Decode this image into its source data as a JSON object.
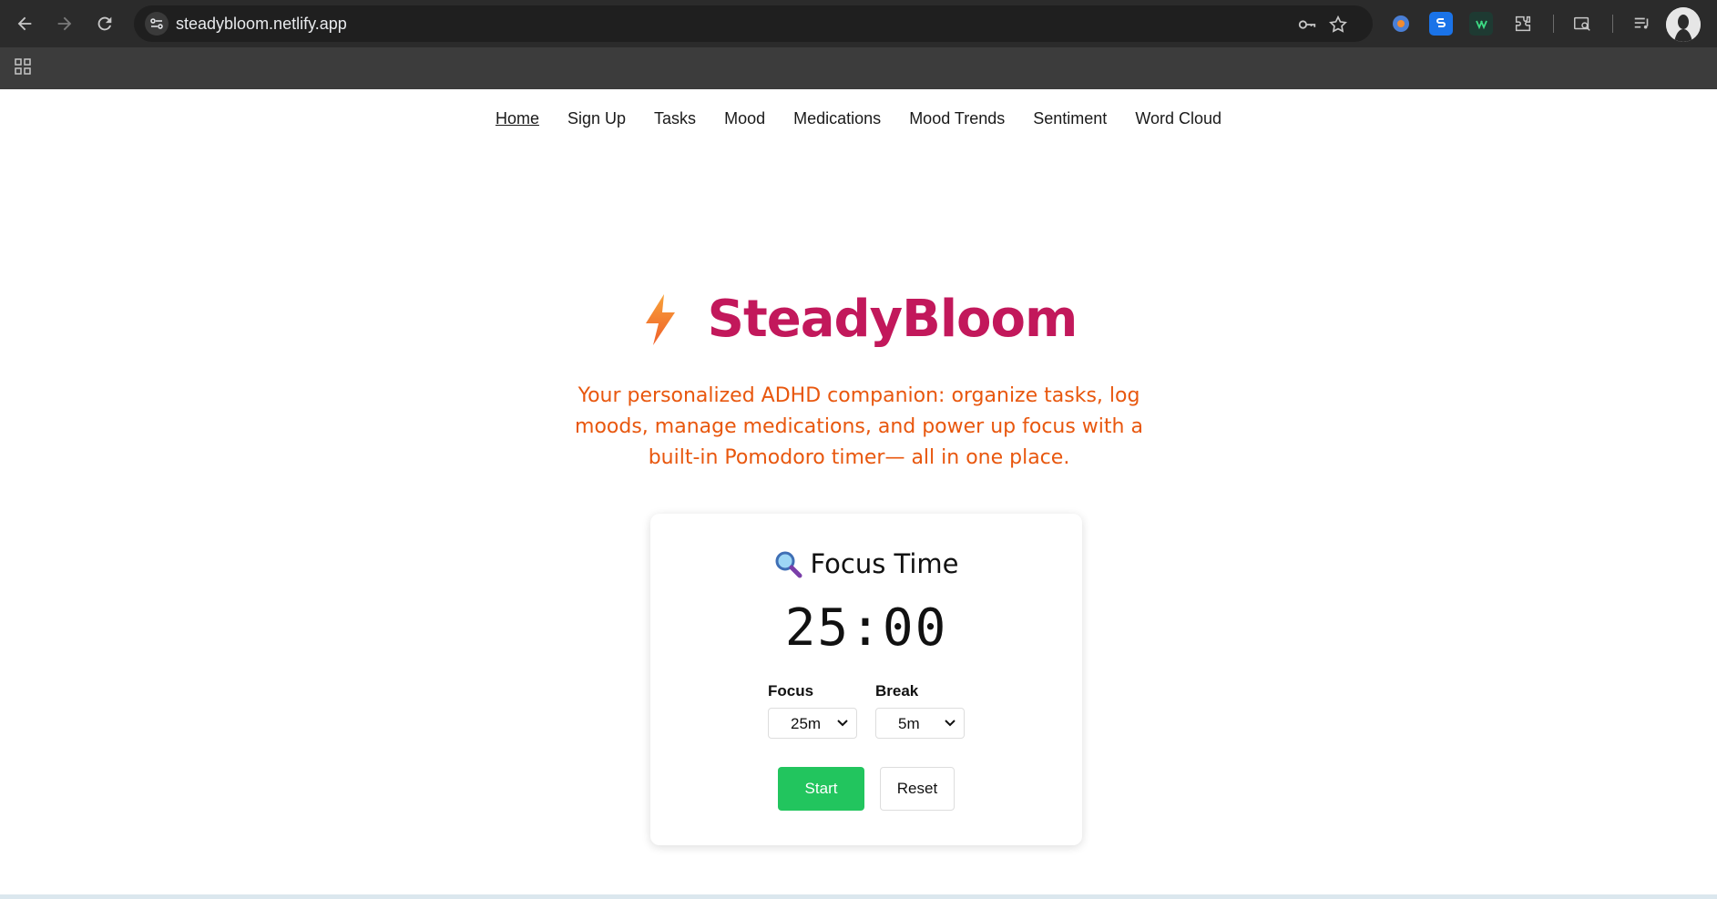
{
  "browser": {
    "url": "steadybloom.netlify.app"
  },
  "nav": {
    "items": [
      "Home",
      "Sign Up",
      "Tasks",
      "Mood",
      "Medications",
      "Mood Trends",
      "Sentiment",
      "Word Cloud"
    ],
    "active": "Home"
  },
  "hero": {
    "brand": "SteadyBloom",
    "tagline": "Your personalized ADHD companion: organize tasks, log moods, manage medications, and power up focus with a built-in Pomodoro timer— all in one place."
  },
  "timer_card": {
    "title": "Focus Time",
    "time": "25:00",
    "focus_label": "Focus",
    "focus_value": "25m",
    "break_label": "Break",
    "break_value": "5m",
    "start_label": "Start",
    "reset_label": "Reset"
  },
  "colors": {
    "brand": "#c2185b",
    "tagline": "#e8570e",
    "start_button": "#22c55e"
  }
}
